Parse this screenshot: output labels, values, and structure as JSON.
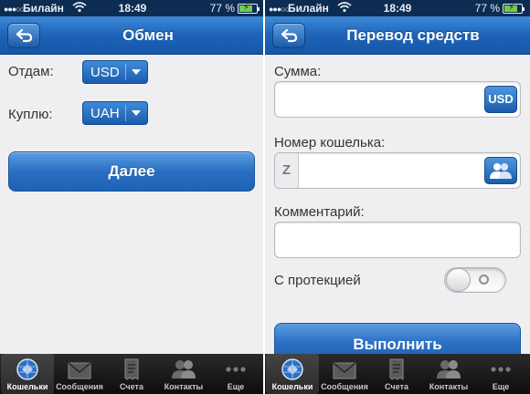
{
  "colors": {
    "accent": "#1d63b8",
    "status_bar": "#0d2c52",
    "background": "#efeff1",
    "tab_bar": "#141414",
    "battery_fill": "#6fd04a"
  },
  "status_bar": {
    "carrier": "Билайн",
    "time": "18:49",
    "battery_percent": "77 %",
    "battery_level": 0.77
  },
  "tab_bar": {
    "items": [
      {
        "label": "Кошельки",
        "icon": "wallet-globe-icon",
        "active": true
      },
      {
        "label": "Сообщения",
        "icon": "envelope-icon",
        "active": false
      },
      {
        "label": "Счета",
        "icon": "receipt-icon",
        "active": false
      },
      {
        "label": "Контакты",
        "icon": "contacts-icon",
        "active": false
      },
      {
        "label": "Еще",
        "icon": "more-dots-icon",
        "active": false
      }
    ]
  },
  "exchange_screen": {
    "title": "Обмен",
    "back_icon": "back-arrow-icon",
    "give_label": "Отдам:",
    "give_currency": "USD",
    "receive_label": "Куплю:",
    "receive_currency": "UAH",
    "next_button": "Далее"
  },
  "transfer_screen": {
    "title": "Перевод средств",
    "back_icon": "back-arrow-icon",
    "amount_label": "Сумма:",
    "amount_value": "",
    "amount_currency_button": "USD",
    "wallet_label": "Номер кошелька:",
    "wallet_prefix": "Z",
    "wallet_value": "",
    "comment_label": "Комментарий:",
    "comment_value": "",
    "protection_label": "С протекцией",
    "protection_enabled": false,
    "execute_button": "Выполнить"
  }
}
